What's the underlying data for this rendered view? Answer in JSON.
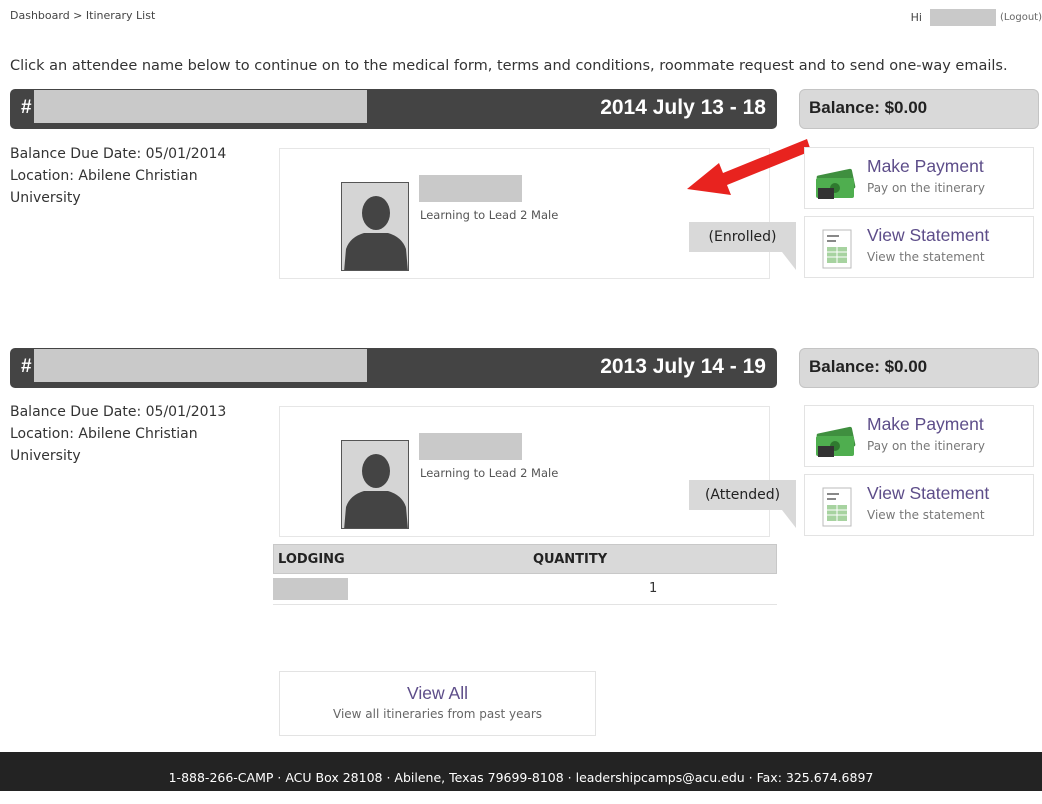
{
  "breadcrumb": {
    "dashboard": "Dashboard",
    "separator": " > ",
    "current": "Itinerary List"
  },
  "greeting": {
    "hi": "Hi",
    "logout": "(Logout)"
  },
  "intro": "Click an attendee name below to continue on to the medical form, terms and conditions, roommate request and to send one-way emails.",
  "itineraries": [
    {
      "hash": "#",
      "date_range": "2014 July 13 - 18",
      "balance": "Balance: $0.00",
      "due_date": "Balance Due Date: 05/01/2014",
      "location": "Location: Abilene Christian University",
      "program": "Learning to Lead 2 Male",
      "status": "(Enrolled)"
    },
    {
      "hash": "#",
      "date_range": "2013 July 14 - 19",
      "balance": "Balance: $0.00",
      "due_date": "Balance Due Date: 05/01/2013",
      "location": "Location: Abilene Christian University",
      "program": "Learning to Lead 2 Male",
      "status": "(Attended)",
      "lodging": {
        "headers": [
          "LODGING",
          "QUANTITY"
        ],
        "rows": [
          {
            "quantity": "1"
          }
        ]
      }
    }
  ],
  "actions": {
    "payment": {
      "title": "Make Payment",
      "subtitle": "Pay on the itinerary",
      "icon": "money-icon"
    },
    "statement": {
      "title": "View Statement",
      "subtitle": "View the statement",
      "icon": "statement-icon"
    }
  },
  "view_all": {
    "title": "View All",
    "subtitle": "View all itineraries from past years"
  },
  "footer": "1-888-266-CAMP · ACU Box 28108 · Abilene, Texas 79699-8108 · leadershipcamps@acu.edu · Fax: 325.674.6897",
  "colors": {
    "header_bg": "#444444",
    "link": "#5d4d89",
    "arrow": "#e8231f",
    "footer_bg": "#232323"
  }
}
